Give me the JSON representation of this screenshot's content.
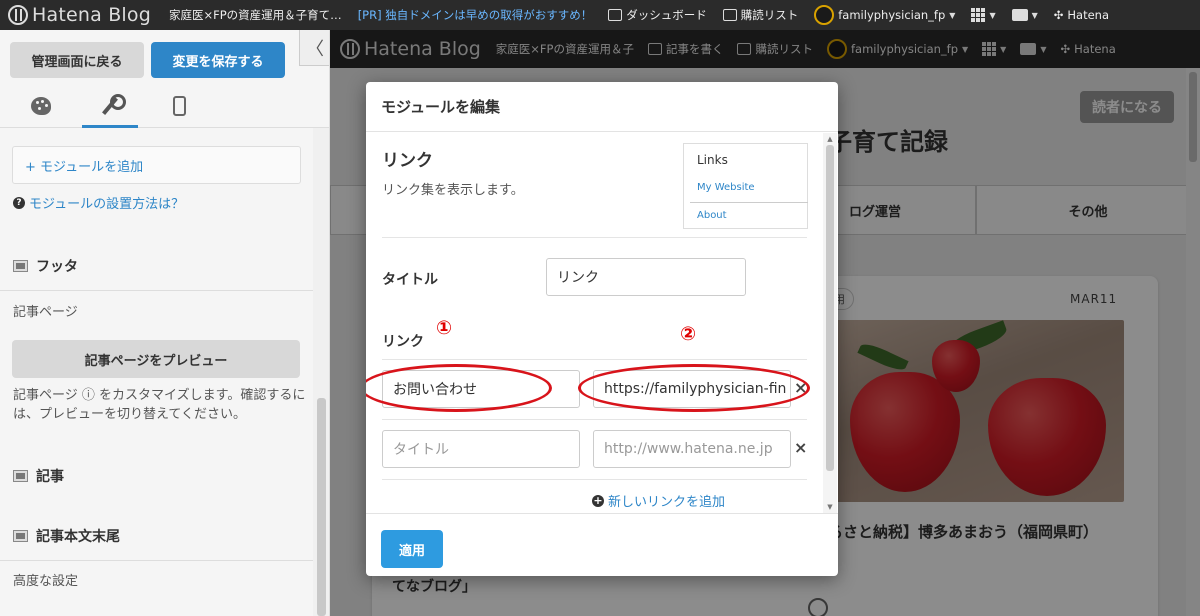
{
  "topbar": {
    "logo": "Hatena Blog",
    "blog_name": "家庭医×FPの資産運用＆子育て…",
    "pr_text": "[PR] 独自ドメインは早めの取得がおすすめ！",
    "dashboard": "ダッシュボード",
    "reading_list": "購読リスト",
    "user": "familyphysician_fp",
    "hatena": "Hatena"
  },
  "sidebar": {
    "back_button": "管理画面に戻る",
    "save_button": "変更を保存する",
    "collapse": "〈",
    "add_module": "+ モジュールを追加",
    "help_link": "モジュールの設置方法は？",
    "footer_section": "フッタ",
    "article_page_label": "記事ページ",
    "preview_button": "記事ページをプレビュー",
    "article_desc": "記事ページ ⓘ をカスタマイズします。確認するには、プレビューを切り替えてください。",
    "article_section": "記事",
    "article_end_section": "記事本文末尾",
    "advanced": "高度な設定"
  },
  "preview": {
    "logo": "Hatena Blog",
    "blog_name": "家庭医×FPの資産運用＆子",
    "write_post": "記事を書く",
    "reading_list": "購読リスト",
    "user": "familyphysician_fp",
    "hatena": "Hatena",
    "reader_button": "読者になる",
    "blog_title_fragment": "子育て記録",
    "nav_items": [
      "",
      "ログ運営",
      "その他"
    ],
    "category_chip": "運用",
    "date": "MAR11",
    "post_title": "るさと納税】博多あまおう（福岡県町）",
    "left_fragment": "てなブログ」"
  },
  "modal": {
    "title": "モジュールを編集",
    "module_name": "リンク",
    "module_desc": "リンク集を表示します。",
    "thumb_title": "Links",
    "thumb_link1": "My Website",
    "thumb_link2": "About",
    "title_label": "タイトル",
    "title_value": "リンク",
    "links_label": "リンク",
    "marker1": "①",
    "marker2": "②",
    "link1_title": "お問い合わせ",
    "link1_url": "https://familyphysician-fin",
    "link2_title_placeholder": "タイトル",
    "link2_url_placeholder": "http://www.hatena.ne.jp",
    "remove": "×",
    "add_link": "新しいリンクを追加",
    "apply_button": "適用"
  },
  "colors": {
    "accent": "#2e86c8",
    "annotation": "#d8141b",
    "topbar": "#2b2b2b"
  }
}
